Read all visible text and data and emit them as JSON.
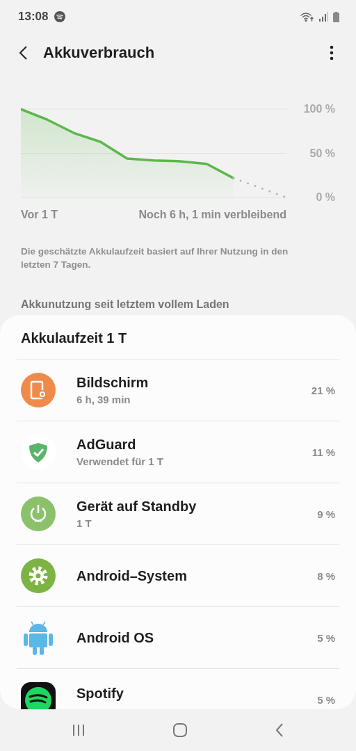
{
  "status_bar": {
    "time": "13:08"
  },
  "header": {
    "title": "Akkuverbrauch"
  },
  "chart": {
    "chart_data": {
      "type": "area",
      "ylim": [
        0,
        100
      ],
      "yticks": [
        {
          "value": 100,
          "label": "100 %"
        },
        {
          "value": 50,
          "label": "50 %"
        },
        {
          "value": 0,
          "label": "0 %"
        }
      ],
      "series": [
        {
          "color": "#5bb84a",
          "values": [
            100,
            88,
            73,
            63,
            44,
            42,
            41,
            38,
            22,
            null,
            null
          ]
        },
        {
          "type": "line",
          "line_style": "dotted",
          "color": "#b5b5b5",
          "values": [
            null,
            null,
            null,
            null,
            null,
            null,
            null,
            null,
            22,
            11,
            0
          ]
        }
      ]
    },
    "start_label": "Vor 1 T",
    "end_label": "Noch 6 h, 1 min verbleibend"
  },
  "note": "Die geschätzte Akkulaufzeit basiert auf Ihrer Nutzung in den letzten 7 Tagen.",
  "section_title": "Akkunutzung seit letztem vollem Laden",
  "card": {
    "title": "Akkulaufzeit 1 T",
    "apps": [
      {
        "kind": "screen",
        "name": "Bildschirm",
        "detail": "6 h, 39 min",
        "percent": "21 %"
      },
      {
        "kind": "shield",
        "name": "AdGuard",
        "detail": "Verwendet für 1 T",
        "percent": "11 %"
      },
      {
        "kind": "power",
        "name": "Gerät auf Standby",
        "detail": "1 T",
        "percent": "9 %"
      },
      {
        "kind": "gear",
        "name": "Android–System",
        "percent": "8 %"
      },
      {
        "kind": "android",
        "name": "Android OS",
        "percent": "5 %"
      },
      {
        "kind": "spotify",
        "name": "Spotify",
        "percent": "5 %"
      }
    ]
  }
}
